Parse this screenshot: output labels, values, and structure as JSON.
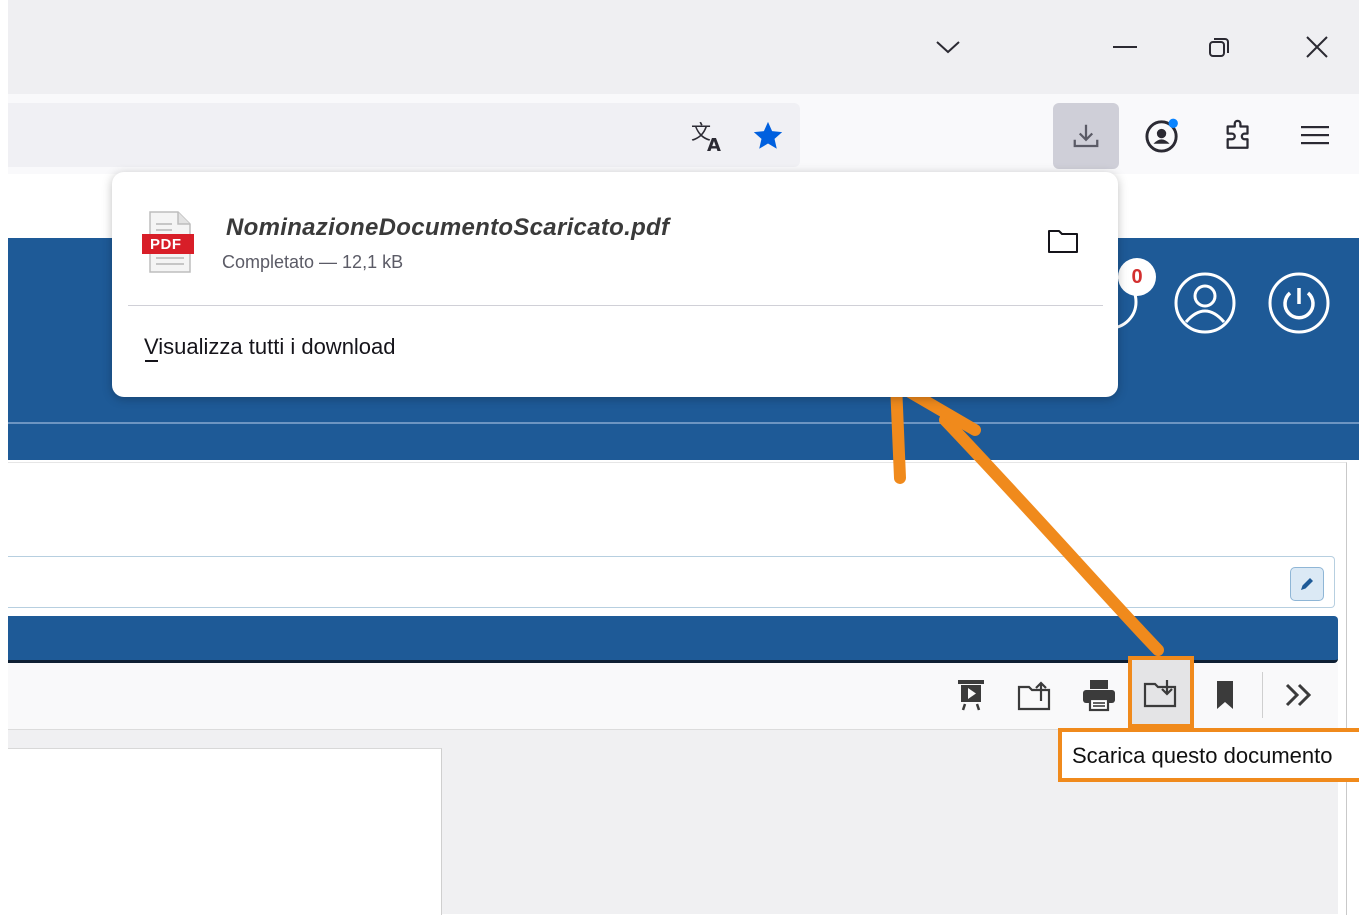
{
  "browser": {
    "tab_list_icon": "chevron-down-icon",
    "window_controls": [
      "minimize-icon",
      "restore-icon",
      "close-icon"
    ],
    "url_actions": [
      "translate-icon",
      "bookmark-star-icon"
    ],
    "toolbar_icons": [
      "downloads-icon",
      "account-icon",
      "extensions-icon",
      "menu-icon"
    ],
    "star_color": "#0060df"
  },
  "downloads_panel": {
    "file_type_label": "PDF",
    "file_name": "NominazioneDocumentoScaricato.pdf",
    "status": "Completato — 12,1 kB",
    "view_all_label": "Visualizza tutti i download"
  },
  "site": {
    "header_color": "#1e5a97",
    "notification_count": "0"
  },
  "pdf_viewer": {
    "toolbar_icons": [
      "presentation-icon",
      "open-icon",
      "print-icon",
      "download-icon",
      "bookmark-icon",
      "more-icon"
    ],
    "tooltip": "Scarica questo documento"
  },
  "annotation": {
    "color": "#f08a1c"
  }
}
